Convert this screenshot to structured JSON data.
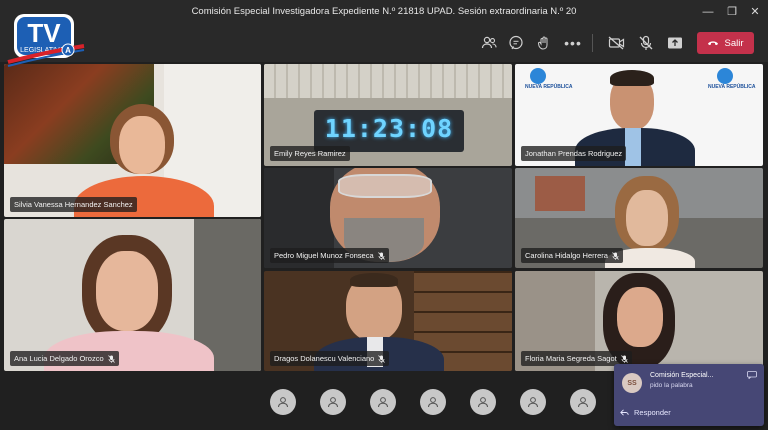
{
  "window": {
    "title": "Comisión Especial Investigadora Expediente N.º 21818 UPAD. Sesión extraordinaria N.º 20",
    "minimize": "—",
    "maximize": "❐",
    "close": "✕"
  },
  "logo": {
    "line1": "TV",
    "line2": "LEGISLATIVA",
    "badge": "A"
  },
  "toolbar": {
    "icons": [
      "people-icon",
      "chat-icon",
      "reactions-icon",
      "more-icon",
      "camera-off-icon",
      "mic-off-icon",
      "share-icon"
    ],
    "leave_label": "Salir"
  },
  "participants": [
    {
      "name": "Silvia Vanessa Hernandez Sanchez",
      "muted": false
    },
    {
      "name": "Emily Reyes Ramirez",
      "muted": false,
      "clock": "11:23:08"
    },
    {
      "name": "Jonathan Prendas Rodriguez",
      "muted": false,
      "backdrop": "NUEVA REPÚBLICA"
    },
    {
      "name": "Pedro Miguel Munoz Fonseca",
      "muted": true
    },
    {
      "name": "Carolina Hidalgo Herrera",
      "muted": true
    },
    {
      "name": "Ana Lucia Delgado Orozco",
      "muted": true
    },
    {
      "name": "Dragos Dolanescu Valenciano",
      "muted": true
    },
    {
      "name": "Floria Maria Segreda Sagot",
      "muted": true
    }
  ],
  "notification": {
    "initials": "SS",
    "from": "Comisión Especial...",
    "message": "pido la palabra",
    "reply_label": "Responder"
  },
  "colors": {
    "leave": "#c4314b",
    "notification": "#464775",
    "titlebar": "#292929"
  }
}
